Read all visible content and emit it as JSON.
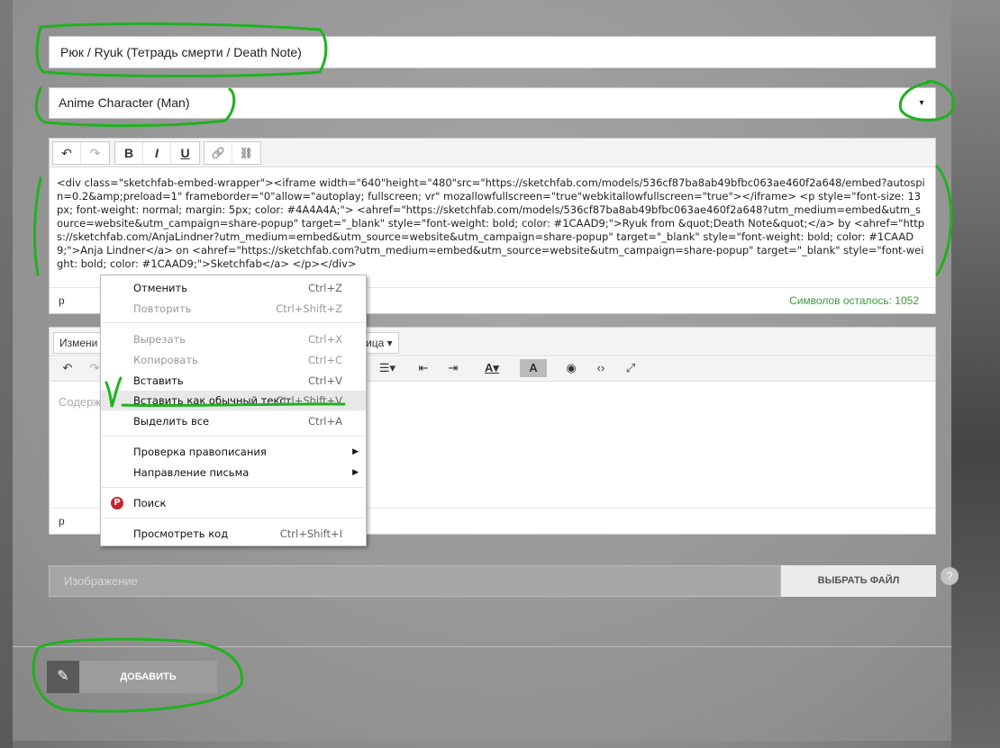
{
  "title_field": {
    "value": "Рюк / Ryuk (Тетрадь смерти / Death Note)"
  },
  "category_select": {
    "value": "Anime Character (Man)",
    "arrow": "▾"
  },
  "editor1": {
    "toolbar": {
      "undo": "↶",
      "redo": "↷",
      "bold": "B",
      "italic": "I",
      "underline": "U",
      "link": "🔗",
      "unlink": "⛓"
    },
    "content": "<div class=\"sketchfab-embed-wrapper\"><iframe width=\"640\"height=\"480\"src=\"https://sketchfab.com/models/536cf87ba8ab49bfbc063ae460f2a648/embed?autospin=0.2&amp;preload=1\" frameborder=\"0\"allow=\"autoplay; fullscreen; vr\" mozallowfullscreen=\"true\"webkitallowfullscreen=\"true\"></iframe> <p style=\"font-size: 13px; font-weight: normal; margin: 5px; color: #4A4A4A;\"> <ahref=\"https://sketchfab.com/models/536cf87ba8ab49bfbc063ae460f2a648?utm_medium=embed&utm_source=website&utm_campaign=share-popup\" target=\"_blank\" style=\"font-weight: bold; color: #1CAAD9;\">Ryuk from &quot;Death Note&quot;</a> by <ahref=\"https://sketchfab.com/AnjaLindner?utm_medium=embed&utm_source=website&utm_campaign=share-popup\" target=\"_blank\" style=\"font-weight: bold; color: #1CAAD9;\">Anja Lindner</a> on <ahref=\"https://sketchfab.com?utm_medium=embed&utm_source=website&utm_campaign=share-popup\" target=\"_blank\" style=\"font-weight: bold; color: #1CAAD9;\">Sketchfab</a> </p></div>",
    "status_tag": "p",
    "chars_left": "Символов осталось: 1052"
  },
  "editor2": {
    "menu": {
      "edit": "Измени",
      "table": "лица ▾"
    },
    "placeholder": "Содерж",
    "status_tag": "p"
  },
  "image_field": {
    "placeholder": "Изображение",
    "button": "ВЫБРАТЬ ФАЙЛ",
    "help": "?"
  },
  "add_button": {
    "label": "ДОБАВИТЬ",
    "icon": "✎"
  },
  "context_menu": {
    "undo": {
      "label": "Отменить",
      "shortcut": "Ctrl+Z"
    },
    "redo": {
      "label": "Повторить",
      "shortcut": "Ctrl+Shift+Z"
    },
    "cut": {
      "label": "Вырезать",
      "shortcut": "Ctrl+X"
    },
    "copy": {
      "label": "Копировать",
      "shortcut": "Ctrl+C"
    },
    "paste": {
      "label": "Вставить",
      "shortcut": "Ctrl+V"
    },
    "paste_plain": {
      "label": "Вставить как обычный текст",
      "shortcut": "Ctrl+Shift+V"
    },
    "select_all": {
      "label": "Выделить все",
      "shortcut": "Ctrl+A"
    },
    "spellcheck": {
      "label": "Проверка правописания"
    },
    "direction": {
      "label": "Направление письма"
    },
    "search": {
      "label": "Поиск",
      "icon": "P"
    },
    "view_source": {
      "label": "Просмотреть код",
      "shortcut": "Ctrl+Shift+I"
    }
  },
  "colors": {
    "annotation": "#1fb21f",
    "accent_green": "#3a9b3a",
    "pinterest": "#c8232c"
  }
}
